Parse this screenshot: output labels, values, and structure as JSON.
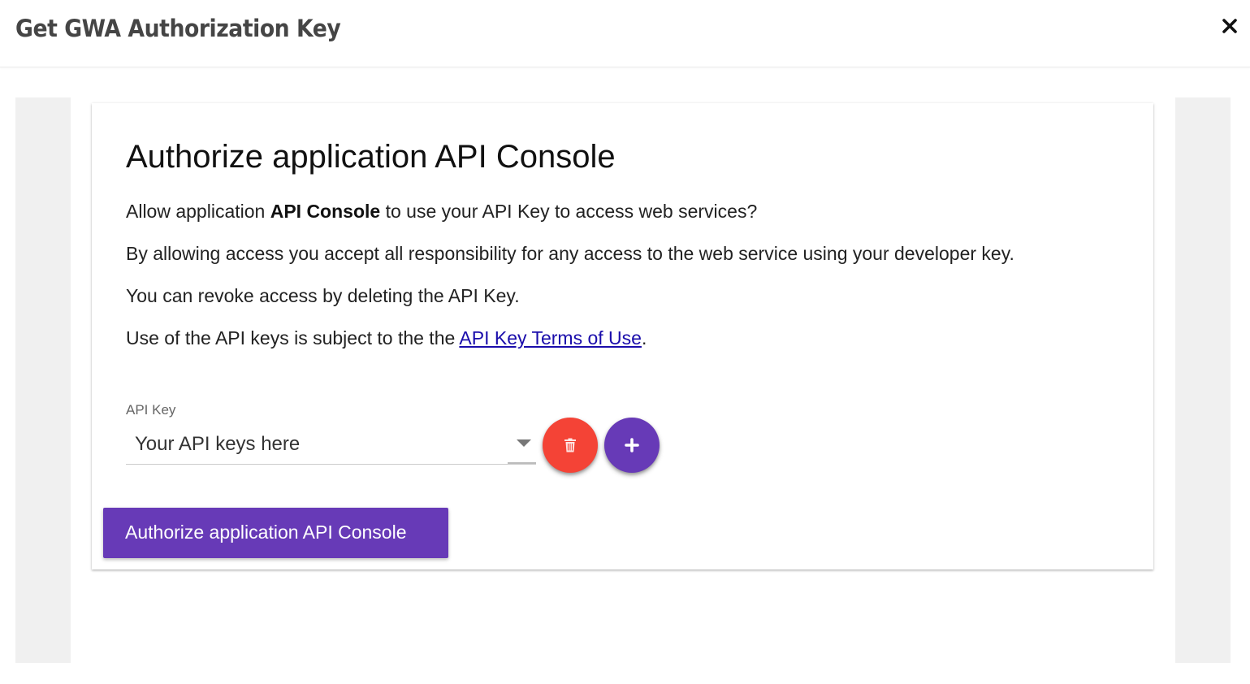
{
  "dialog": {
    "title": "Get GWA Authorization Key",
    "close_icon": "close-icon"
  },
  "card": {
    "heading": "Authorize application API Console",
    "paragraph1": {
      "prefix": "Allow application ",
      "app_name": "API Console",
      "suffix": " to use your API Key to access web services?"
    },
    "paragraph2": "By allowing access you accept all responsibility for any access to the web service using your developer key.",
    "paragraph3": "You can revoke access by deleting the API Key.",
    "paragraph4": {
      "prefix": "Use of the API keys is subject to the the ",
      "link_text": "API Key Terms of Use",
      "suffix": "."
    }
  },
  "api_key_field": {
    "label": "API Key",
    "selected_value": "Your API keys here",
    "delete_icon": "trash-icon",
    "add_icon": "plus-icon"
  },
  "authorize_button": {
    "label": "Authorize application API Console"
  },
  "colors": {
    "primary": "#673ab7",
    "danger": "#f44336",
    "link": "#1a0dab",
    "side_panel": "#f0f0f0"
  }
}
